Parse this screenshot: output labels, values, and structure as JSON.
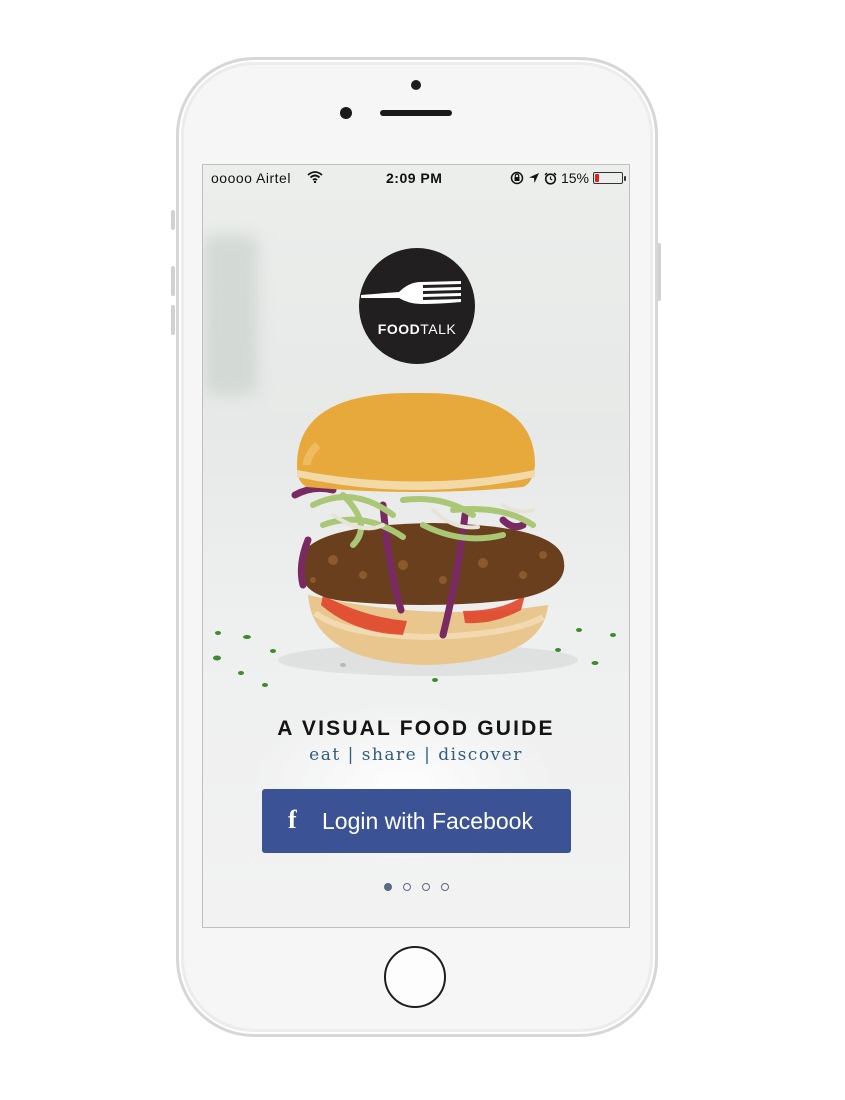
{
  "status_bar": {
    "carrier": "ooooo Airtel",
    "time": "2:09 PM",
    "battery_percent": "15%",
    "battery_level": 0.15,
    "icons": [
      "wifi-icon",
      "rotation-lock-icon",
      "location-icon",
      "alarm-icon",
      "battery-icon"
    ]
  },
  "logo": {
    "text_bold": "FOOD",
    "text_light": "TALK",
    "icon": "fork-icon"
  },
  "hero": {
    "headline": "A VISUAL FOOD GUIDE",
    "tagline": "eat | share | discover"
  },
  "login": {
    "icon_glyph": "f",
    "label": "Login with Facebook"
  },
  "pagination": {
    "pages": 4,
    "current": 1
  },
  "colors": {
    "facebook_blue": "#3b5394",
    "tagline_blue": "#2f5d83",
    "logo_dark": "#211f1f",
    "battery_red": "#e0201f"
  }
}
